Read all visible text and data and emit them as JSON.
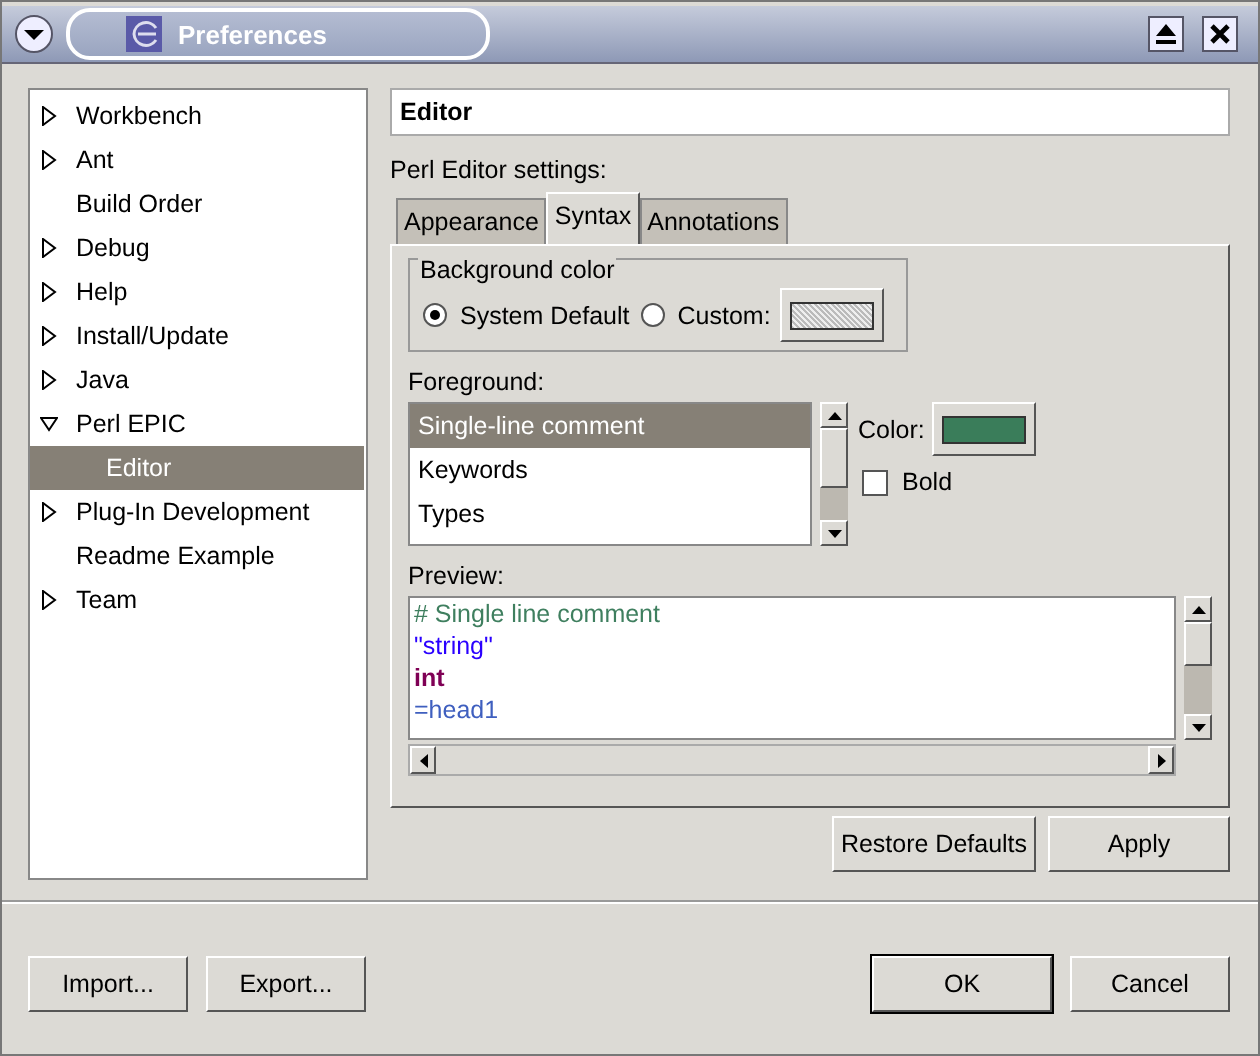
{
  "window": {
    "title": "Preferences"
  },
  "tree": [
    {
      "label": "Workbench",
      "expandable": true,
      "expanded": false,
      "selected": false
    },
    {
      "label": "Ant",
      "expandable": true,
      "expanded": false,
      "selected": false
    },
    {
      "label": "Build Order",
      "expandable": false,
      "selected": false
    },
    {
      "label": "Debug",
      "expandable": true,
      "expanded": false,
      "selected": false
    },
    {
      "label": "Help",
      "expandable": true,
      "expanded": false,
      "selected": false
    },
    {
      "label": "Install/Update",
      "expandable": true,
      "expanded": false,
      "selected": false
    },
    {
      "label": "Java",
      "expandable": true,
      "expanded": false,
      "selected": false
    },
    {
      "label": "Perl EPIC",
      "expandable": true,
      "expanded": true,
      "selected": false,
      "children": [
        {
          "label": "Editor",
          "selected": true
        }
      ]
    },
    {
      "label": "Plug-In Development",
      "expandable": true,
      "expanded": false,
      "selected": false
    },
    {
      "label": "Readme Example",
      "expandable": false,
      "selected": false
    },
    {
      "label": "Team",
      "expandable": true,
      "expanded": false,
      "selected": false
    }
  ],
  "page": {
    "title": "Editor",
    "subtitle": "Perl Editor settings:",
    "tabs": [
      {
        "label": "Appearance",
        "selected": false
      },
      {
        "label": "Syntax",
        "selected": true
      },
      {
        "label": "Annotations",
        "selected": false
      }
    ],
    "background": {
      "legend": "Background color",
      "options": [
        {
          "label": "System Default",
          "selected": true
        },
        {
          "label": "Custom:",
          "selected": false
        }
      ]
    },
    "foreground": {
      "label": "Foreground:",
      "items": [
        {
          "label": "Single-line comment",
          "selected": true
        },
        {
          "label": "Keywords",
          "selected": false
        },
        {
          "label": "Types",
          "selected": false
        }
      ],
      "color_label": "Color:",
      "color": "#3a7d5a",
      "bold_label": "Bold",
      "bold_checked": false
    },
    "preview": {
      "label": "Preview:",
      "lines": [
        {
          "text": "# Single line comment",
          "color": "#3f7f5f",
          "bold": false
        },
        {
          "text": "\"string\"",
          "color": "#2a00ff",
          "bold": false
        },
        {
          "text": "int",
          "color": "#7f0055",
          "bold": true
        },
        {
          "text": "=head1",
          "color": "#3f5fbf",
          "bold": false
        }
      ]
    },
    "buttons": [
      "Restore Defaults",
      "Apply"
    ]
  },
  "footer": {
    "left_buttons": [
      "Import...",
      "Export..."
    ],
    "right_buttons": [
      "OK",
      "Cancel"
    ]
  }
}
